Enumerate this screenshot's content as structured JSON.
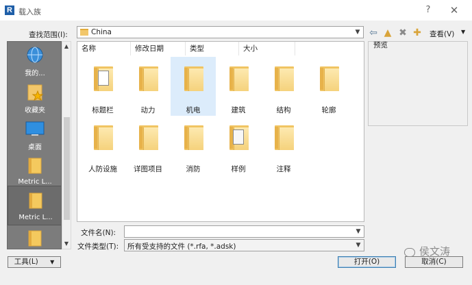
{
  "window": {
    "title": "载入族",
    "app_letter": "R",
    "help": "?",
    "close": "✕"
  },
  "lookin": {
    "label": "查找范围(I):",
    "value": "China",
    "views_label": "查看(V)"
  },
  "toolbar_icons": [
    "back-arrow-icon",
    "up-folder-icon",
    "delete-icon",
    "new-folder-icon"
  ],
  "places": [
    {
      "label": "我的...",
      "icon": "network-globe-icon"
    },
    {
      "label": "收藏夹",
      "icon": "favorites-folder-icon"
    },
    {
      "label": "桌面",
      "icon": "desktop-icon"
    },
    {
      "label": "Metric L...",
      "icon": "folder-icon"
    },
    {
      "label": "Metric L...",
      "icon": "folder-icon"
    }
  ],
  "columns": [
    "名称",
    "修改日期",
    "类型",
    "大小"
  ],
  "files": [
    {
      "label": "标题栏",
      "icon": "folder-doc-icon"
    },
    {
      "label": "动力",
      "icon": "folder-icon"
    },
    {
      "label": "机电",
      "icon": "folder-icon"
    },
    {
      "label": "建筑",
      "icon": "folder-icon"
    },
    {
      "label": "结构",
      "icon": "folder-icon"
    },
    {
      "label": "轮廓",
      "icon": "folder-icon"
    },
    {
      "label": "人防设施",
      "icon": "folder-icon"
    },
    {
      "label": "详图项目",
      "icon": "folder-icon"
    },
    {
      "label": "消防",
      "icon": "folder-icon"
    },
    {
      "label": "样例",
      "icon": "folder-doc-icon"
    },
    {
      "label": "注释",
      "icon": "folder-icon"
    }
  ],
  "preview_label": "预览",
  "filename": {
    "label": "文件名(N):",
    "value": ""
  },
  "filetype": {
    "label": "文件类型(T):",
    "value": "所有受支持的文件 (*.rfa, *.adsk)"
  },
  "buttons": {
    "tools": "工具(L)",
    "open": "打开(O)",
    "cancel": "取消(C)"
  },
  "watermark": "侯文涛",
  "colors": {
    "folder": "#f2c76b",
    "places_bg": "#7c7c7c",
    "selected": "#dcecfb"
  }
}
